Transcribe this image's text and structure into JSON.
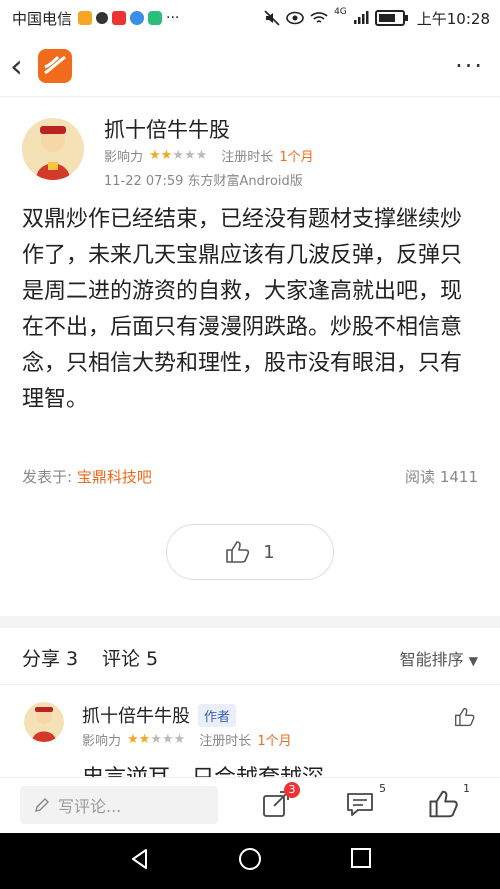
{
  "status_bar": {
    "carrier": "中国电信",
    "time": "上午10:28",
    "network": "4G"
  },
  "post": {
    "author_name": "抓十倍牛牛股",
    "influence_label": "影响力",
    "influence_stars": 2,
    "influence_max": 5,
    "reg_label": "注册时长",
    "reg_value": "1个月",
    "date_source": "11-22 07:59 东方财富Android版",
    "content": "双鼎炒作已经结束，已经没有题材支撑继续炒作了，未来几天宝鼎应该有几波反弹，反弹只是周二进的游资的自救，大家逢高就出吧，现在不出，后面只有漫漫阴跌路。炒股不相信意念，只相信大势和理性，股市没有眼泪，只有理智。",
    "posted_in_label": "发表于:",
    "posted_in_bar": "宝鼎科技吧",
    "reads": "阅读 1411",
    "like_count": "1"
  },
  "tabs": {
    "share": "分享 3",
    "comments": "评论 5",
    "sort": "智能排序"
  },
  "comment": {
    "author_name": "抓十倍牛牛股",
    "badge": "作者",
    "influence_label": "影响力",
    "influence_stars": 2,
    "reg_label": "注册时长",
    "reg_value": "1个月",
    "text_partial": "忠言逆耳，只会越套越深"
  },
  "bottom_bar": {
    "write_placeholder": "写评论...",
    "share_badge": "3",
    "comment_count": "5",
    "like_count": "1"
  },
  "colors": {
    "accent": "#f26a1b",
    "star": "#f5a623"
  }
}
